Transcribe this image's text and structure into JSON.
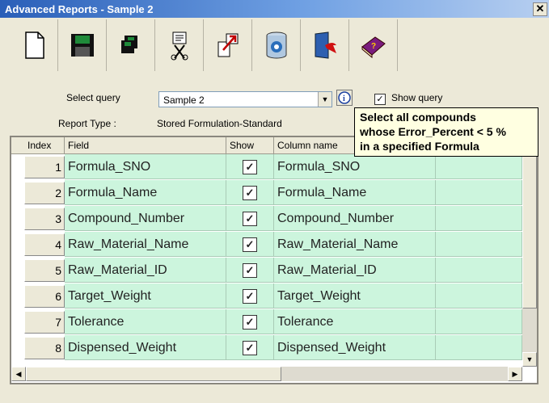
{
  "window": {
    "title": "Advanced Reports - Sample 2",
    "close": "✕"
  },
  "toolbar": {
    "buttons": [
      {
        "icon": "new-document-icon"
      },
      {
        "icon": "save-icon"
      },
      {
        "icon": "save-all-icon"
      },
      {
        "icon": "print-preview-icon"
      },
      {
        "icon": "export-icon"
      },
      {
        "icon": "database-icon"
      },
      {
        "icon": "exit-door-icon"
      },
      {
        "icon": "help-book-icon"
      }
    ]
  },
  "query": {
    "select_label": "Select query",
    "selected": "Sample 2",
    "show_query_label": "Show query",
    "show_query_checked": "✓",
    "report_type_label": "Report Type :",
    "report_type_value": "Stored Formulation-Standard"
  },
  "tooltip": {
    "lines": [
      "Select all compounds",
      "whose Error_Percent < 5 %",
      "in a specified Formula"
    ]
  },
  "grid": {
    "headers": {
      "index": "Index",
      "field": "Field",
      "show": "Show",
      "column": "Column name"
    },
    "rows": [
      {
        "index": "1",
        "field": "Formula_SNO",
        "show": "✓",
        "column": "Formula_SNO"
      },
      {
        "index": "2",
        "field": "Formula_Name",
        "show": "✓",
        "column": "Formula_Name"
      },
      {
        "index": "3",
        "field": "Compound_Number",
        "show": "✓",
        "column": "Compound_Number"
      },
      {
        "index": "4",
        "field": "Raw_Material_Name",
        "show": "✓",
        "column": "Raw_Material_Name"
      },
      {
        "index": "5",
        "field": "Raw_Material_ID",
        "show": "✓",
        "column": "Raw_Material_ID"
      },
      {
        "index": "6",
        "field": "Target_Weight",
        "show": "✓",
        "column": "Target_Weight"
      },
      {
        "index": "7",
        "field": "Tolerance",
        "show": "✓",
        "column": "Tolerance"
      },
      {
        "index": "8",
        "field": "Dispensed_Weight",
        "show": "✓",
        "column": "Dispensed_Weight"
      }
    ]
  },
  "colors": {
    "row_bg": "#ccf5dd",
    "titlebar": "#2a5fb8",
    "tooltip_bg": "#ffffe1"
  }
}
